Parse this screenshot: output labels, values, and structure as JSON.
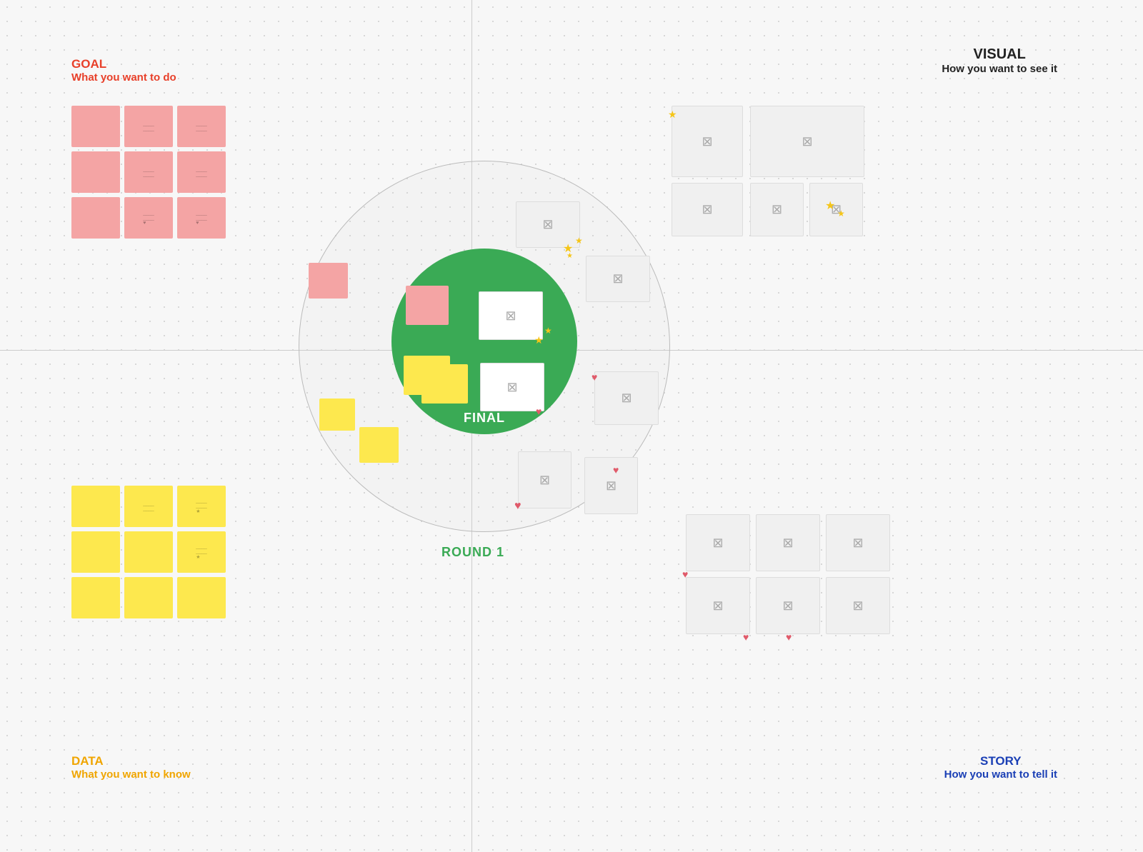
{
  "labels": {
    "goal_main": "GOAL",
    "goal_sub": "What you want to do",
    "visual_main": "VISUAL",
    "visual_sub": "How you want to see it",
    "data_main": "DATA",
    "data_sub": "What you want to know",
    "story_main": "STORY",
    "story_sub": "How you want to tell it",
    "final_label": "FINAL",
    "round1_label": "ROUND 1"
  },
  "colors": {
    "goal": "#e8402a",
    "visual": "#222222",
    "data": "#f0a500",
    "story": "#1a3fb5",
    "green": "#3aaa55",
    "pink_sticky": "#f4a4a4",
    "yellow_sticky": "#fde84e",
    "gray_card": "#e8e8e8",
    "star": "#f5c518",
    "heart": "#e05a6a"
  }
}
